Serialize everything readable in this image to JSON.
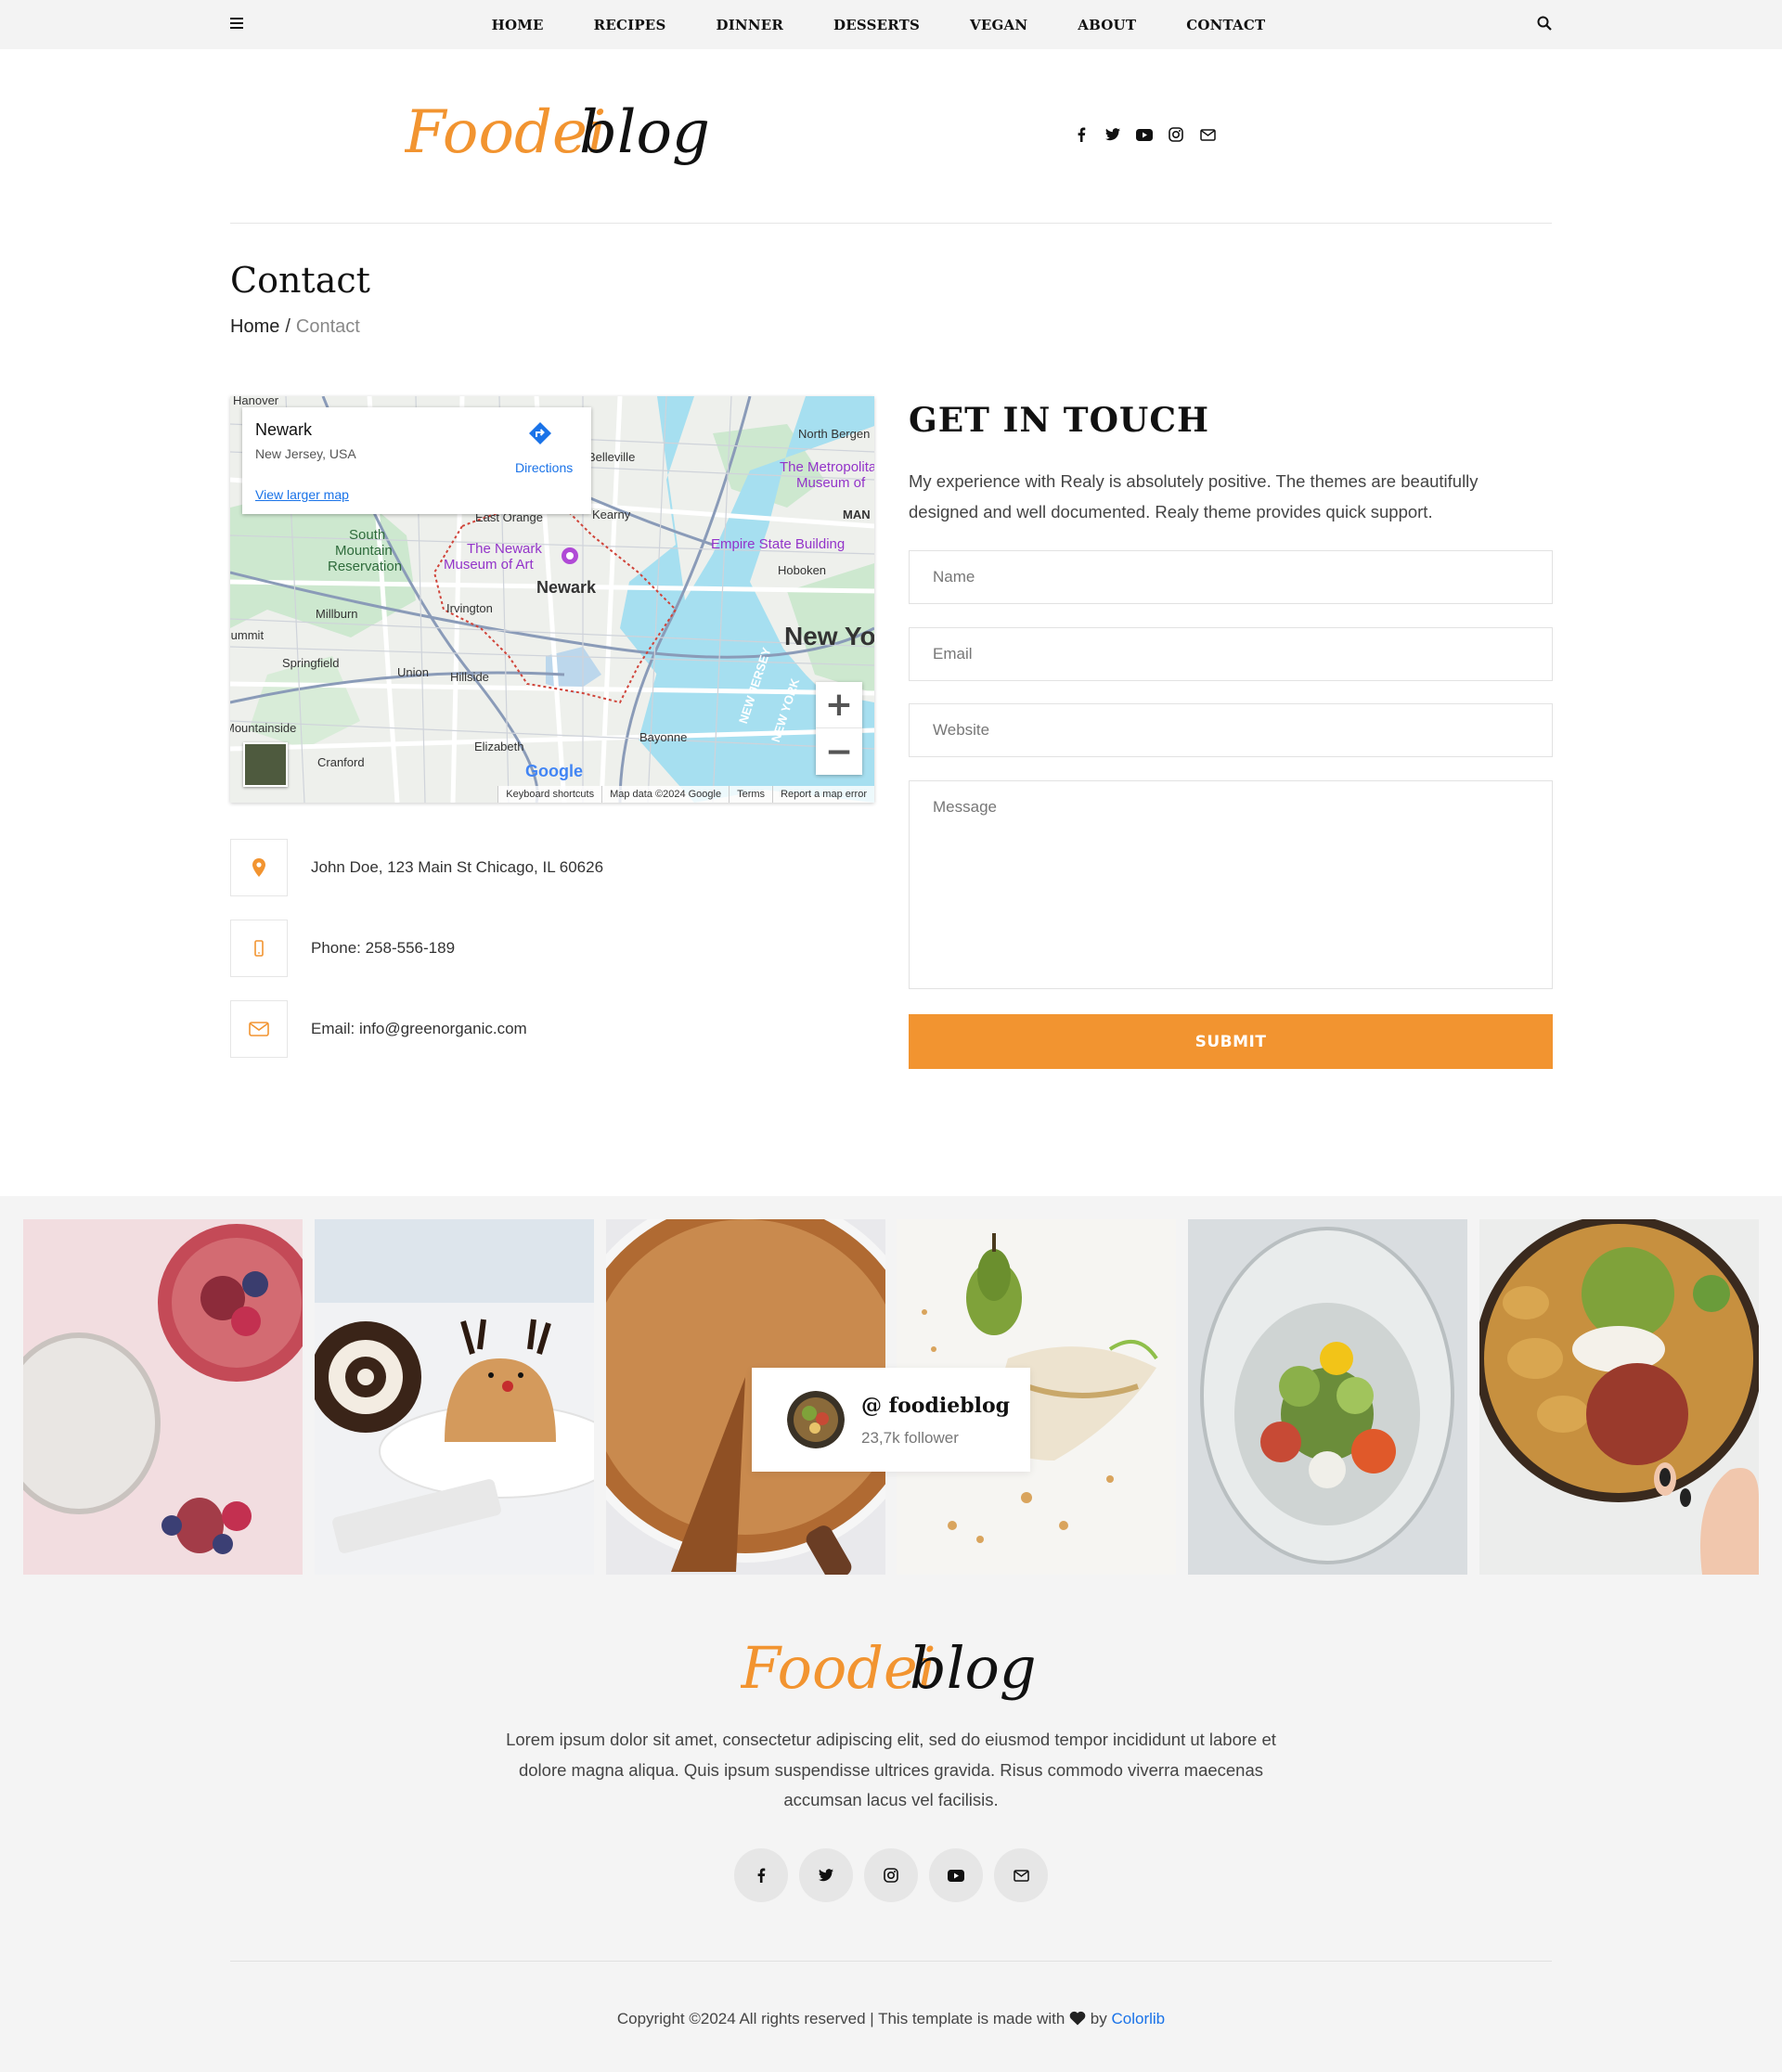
{
  "nav": {
    "items": [
      "HOME",
      "RECIPES",
      "DINNER",
      "DESSERTS",
      "VEGAN",
      "ABOUT",
      "CONTACT"
    ]
  },
  "brand": {
    "logo_part1": "Foodei",
    "logo_part2": "blog",
    "accent_color": "#f29430"
  },
  "page": {
    "title": "Contact",
    "breadcrumb": {
      "home": "Home",
      "separator": "/",
      "current": "Contact"
    }
  },
  "map": {
    "place_name": "Newark",
    "place_region": "New Jersey, USA",
    "directions_label": "Directions",
    "larger_map_label": "View larger map",
    "google_label": "Google",
    "zoom_in": "+",
    "zoom_out": "−",
    "footer": [
      "Keyboard shortcuts",
      "Map data ©2024 Google",
      "Terms",
      "Report a map error"
    ],
    "labels": [
      "Hanover",
      "North Bergen",
      "Belleville",
      "The Metropolitan",
      "Museum of",
      "East Orange",
      "Kearny",
      "MAN",
      "South",
      "Mountain",
      "Reservation",
      "The Newark",
      "Museum of Art",
      "Empire State Building",
      "Newark",
      "Hoboken",
      "Irvington",
      "Millburn",
      "Summit",
      "Springfield",
      "Union",
      "Hillside",
      "New Yo",
      "Mountainside",
      "Elizabeth",
      "Bayonne",
      "Cranford",
      "NEW JERSEY",
      "NEW YORK"
    ]
  },
  "contact_info": {
    "address": "John Doe, 123 Main St Chicago, IL 60626",
    "phone": "Phone: 258-556-189",
    "email": "Email: info@greenorganic.com"
  },
  "form": {
    "heading": "GET IN TOUCH",
    "intro": "My experience with Realy is absolutely positive. The themes are beautifully designed and well documented. Realy theme provides quick support.",
    "name_placeholder": "Name",
    "email_placeholder": "Email",
    "website_placeholder": "Website",
    "message_placeholder": "Message",
    "submit_label": "SUBMIT"
  },
  "instagram": {
    "handle": "@ foodieblog",
    "followers": "23,7k follower"
  },
  "footer": {
    "text": "Lorem ipsum dolor sit amet, consectetur adipiscing elit, sed do eiusmod tempor incididunt ut labore et dolore magna aliqua. Quis ipsum suspendisse ultrices gravida. Risus commodo viverra maecenas accumsan lacus vel facilisis.",
    "copyright_prefix": "Copyright ©2024 All rights reserved | This template is made with",
    "copyright_by": "by",
    "copyright_link": "Colorlib"
  },
  "icons": {
    "social": [
      "facebook-icon",
      "twitter-icon",
      "youtube-icon",
      "instagram-icon",
      "envelope-icon"
    ]
  }
}
